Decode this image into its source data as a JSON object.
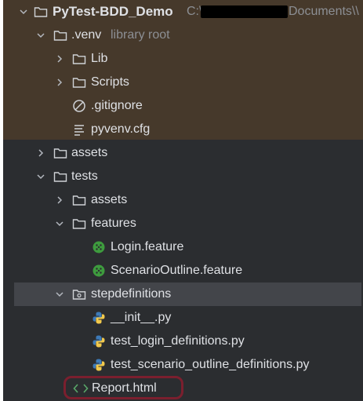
{
  "tree": {
    "root": {
      "name": "PyTest-BDD_Demo",
      "path_prefix": "C:\\",
      "path_suffix": "Documents\\\\"
    },
    "venv": {
      "name": ".venv",
      "hint": "library root"
    },
    "lib": {
      "name": "Lib"
    },
    "scripts": {
      "name": "Scripts"
    },
    "gitignore": {
      "name": ".gitignore"
    },
    "pyvenv": {
      "name": "pyvenv.cfg"
    },
    "assets_root": {
      "name": "assets"
    },
    "tests": {
      "name": "tests"
    },
    "tests_assets": {
      "name": "assets"
    },
    "features": {
      "name": "features"
    },
    "login_feature": {
      "name": "Login.feature"
    },
    "scenario_feature": {
      "name": "ScenarioOutline.feature"
    },
    "stepdefinitions": {
      "name": "stepdefinitions"
    },
    "init_py": {
      "name": "__init__.py"
    },
    "login_defs": {
      "name": "test_login_definitions.py"
    },
    "scenario_defs": {
      "name": "test_scenario_outline_definitions.py"
    },
    "report": {
      "name": "Report.html"
    }
  },
  "colors": {
    "background": "#2b2d30",
    "highlight_band": "#46392b",
    "selection": "#43454a",
    "text": "#dfe1e5",
    "hint": "#8c8f94",
    "report_outline": "#7b1f2e",
    "cucumber": "#3e9c3e",
    "html_icon": "#59a869"
  }
}
